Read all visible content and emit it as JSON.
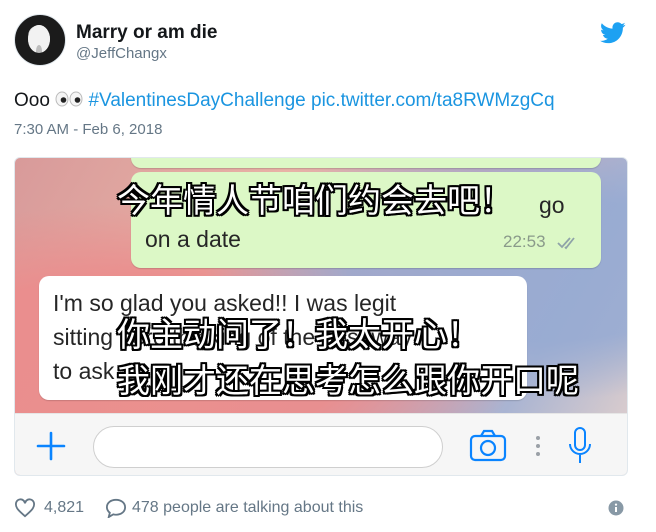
{
  "user": {
    "display_name": "Marry or am die",
    "handle": "@JeffChangx",
    "avatar_icon": "avatar"
  },
  "tweet": {
    "text_prefix": "Ooo",
    "emoji": "eyes-emoji",
    "hashtag": "#ValentinesDayChallenge",
    "link": "pic.twitter.com/ta8RWMzgCq",
    "timestamp": "7:30 AM - Feb 6, 2018"
  },
  "media": {
    "sent_message_fragment": "go",
    "sent_message_line": "on a date",
    "sent_time": "22:53",
    "received_lines": [
      "I'm so glad you asked!! I was legit",
      "sitting here thinking of the best way",
      "to ask"
    ],
    "overlay_captions": [
      "今年情人节咱们约会去吧！",
      "你主动问了！我太开心！",
      "我刚才还在思考怎么跟你开口呢"
    ],
    "input_placeholder": ""
  },
  "footer": {
    "likes": "4,821",
    "talking": "478 people are talking about this"
  },
  "colors": {
    "link": "#1b95e0",
    "twitter_blue": "#1da1f2",
    "sent_bubble": "#dcf8c6",
    "whatsapp_blue": "#0a84ff"
  }
}
